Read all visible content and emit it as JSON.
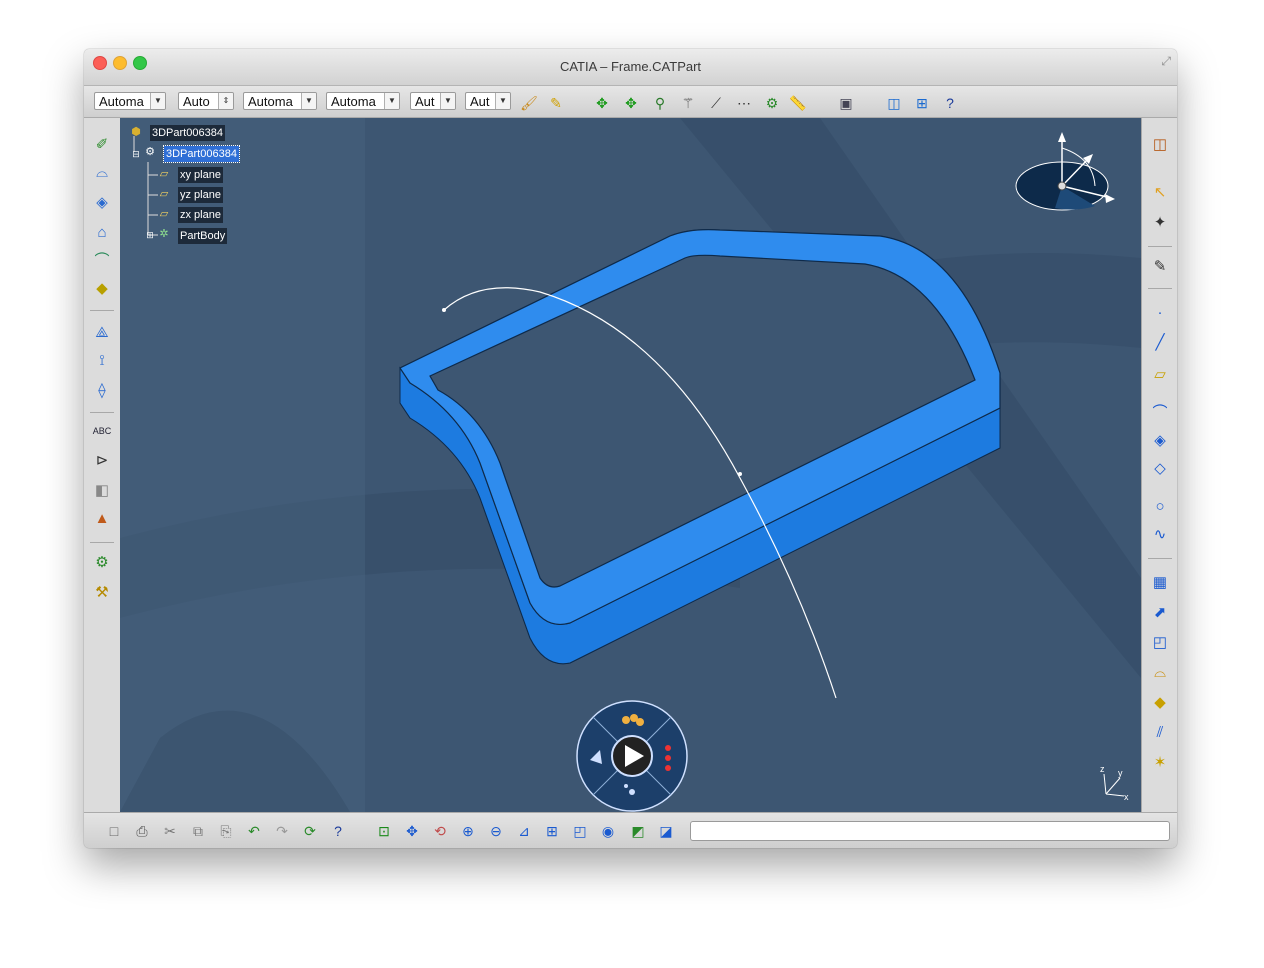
{
  "window": {
    "title": "CATIA – Frame.CATPart"
  },
  "top_toolbar": {
    "combos": [
      {
        "value": "Automa"
      },
      {
        "value": "Auto"
      },
      {
        "value": "Automa"
      },
      {
        "value": "Automa"
      },
      {
        "value": "Aut"
      },
      {
        "value": "Aut"
      }
    ],
    "icons": [
      "paint-brush-icon",
      "painter-icon",
      "move-icon",
      "rotate-icon",
      "snap-icon",
      "magic-wand-icon",
      "segment-icon",
      "dots-icon",
      "analysis-icon",
      "ruler-icon",
      "product-icon",
      "plane-icon",
      "grid-icon",
      "whats-this-icon"
    ]
  },
  "tree": {
    "root": "3DPart006384",
    "part": "3DPart006384",
    "planes": [
      "xy plane",
      "yz plane",
      "zx plane"
    ],
    "body": "PartBody"
  },
  "compass": {
    "axes": [
      "z",
      "y",
      "x"
    ]
  },
  "colors": {
    "viewport": "#3d5672",
    "frame": "#2f8cee",
    "frame_dark": "#1a5fb3",
    "selection": "#2f6fd6"
  },
  "command_input": {
    "value": ""
  }
}
